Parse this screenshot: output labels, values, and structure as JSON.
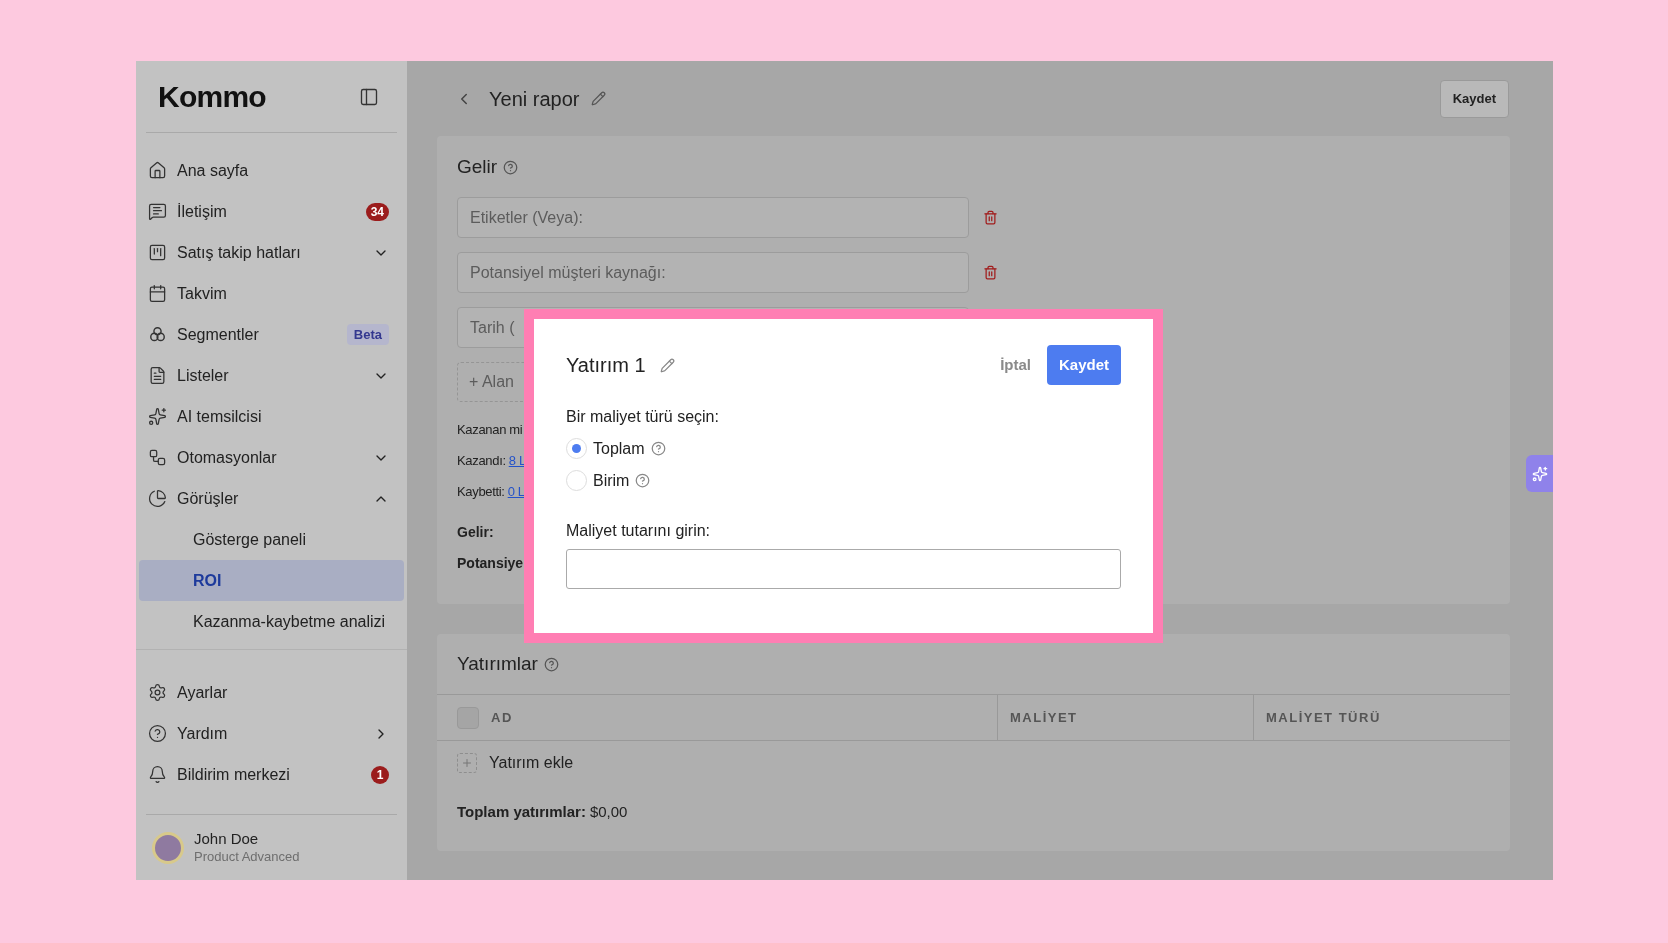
{
  "sidebar": {
    "logo": "Kommo",
    "items": [
      {
        "label": "Ana sayfa",
        "kind": "plain"
      },
      {
        "label": "İletişim",
        "kind": "badge",
        "badge": "34"
      },
      {
        "label": "Satış takip hatları",
        "kind": "group",
        "expanded": false
      },
      {
        "label": "Takvim",
        "kind": "plain"
      },
      {
        "label": "Segmentler",
        "kind": "tag",
        "badge": "Beta"
      },
      {
        "label": "Listeler",
        "kind": "group",
        "expanded": false
      },
      {
        "label": "AI temsilcisi",
        "kind": "plain"
      },
      {
        "label": "Otomasyonlar",
        "kind": "group",
        "expanded": false
      },
      {
        "label": "Görüşler",
        "kind": "group",
        "expanded": true,
        "children": [
          {
            "label": "Gösterge paneli",
            "selected": false
          },
          {
            "label": "ROI",
            "selected": true
          },
          {
            "label": "Kazanma-kaybetme analizi",
            "selected": false
          }
        ]
      }
    ],
    "footer_items": [
      {
        "label": "Ayarlar",
        "kind": "plain"
      },
      {
        "label": "Yardım",
        "kind": "submenu"
      },
      {
        "label": "Bildirim merkezi",
        "kind": "badge",
        "badge": "1"
      }
    ],
    "user": {
      "name": "John Doe",
      "plan": "Product Advanced"
    }
  },
  "header": {
    "title": "Yeni rapor",
    "save": "Kaydet"
  },
  "revenue": {
    "title": "Gelir",
    "filters": [
      {
        "label": "Etiketler (Veya):",
        "delete_icon": true
      },
      {
        "label": "Potansiyel müşteri kaynağı:",
        "delete_icon": true
      },
      {
        "label": "Tarih (",
        "delete_icon": false
      }
    ],
    "add_field": "+ Alan",
    "stats": [
      {
        "label": "Kazanan mi"
      },
      {
        "label": "Kazandı:",
        "link": "8 L"
      },
      {
        "label": "Kaybetti:",
        "link": "0 L"
      }
    ],
    "totals": [
      "Gelir:",
      "Potansiye"
    ]
  },
  "investments": {
    "title": "Yatırımlar",
    "columns": [
      "AD",
      "MALİYET",
      "MALİYET TÜRÜ"
    ],
    "select_all": {
      "checked": false
    },
    "add_row": "Yatırım ekle",
    "total_label": "Toplam yatırımlar:",
    "total_value": "$0,00"
  },
  "modal": {
    "title": "Yatırım 1",
    "cancel": "İptal",
    "save": "Kaydet",
    "question": "Bir maliyet türü seçin:",
    "options": [
      {
        "label": "Toplam",
        "selected": true
      },
      {
        "label": "Birim",
        "selected": false
      }
    ],
    "amount_label": "Maliyet tutarını girin:"
  }
}
